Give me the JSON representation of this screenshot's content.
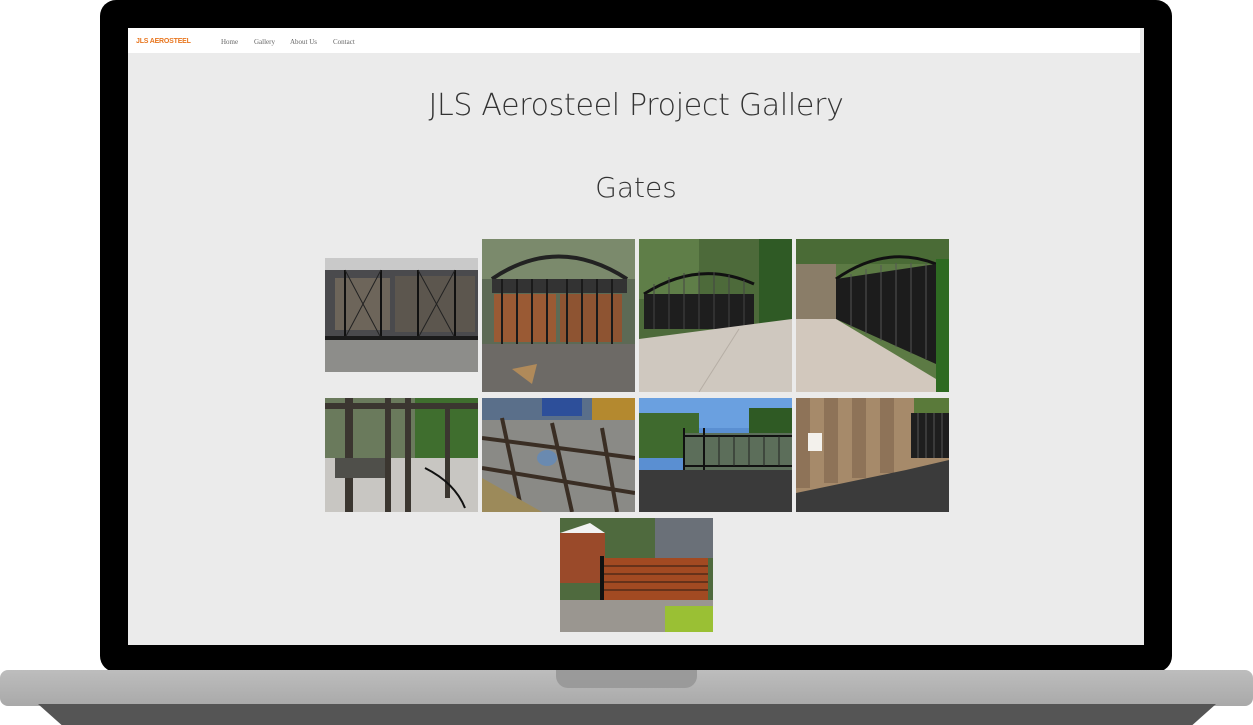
{
  "nav": {
    "brand": "JLS AEROSTEEL",
    "links": [
      "Home",
      "Gallery",
      "About Us",
      "Contact"
    ]
  },
  "main": {
    "title": "JLS Aerosteel Project Gallery",
    "section": "Gates"
  },
  "gallery": {
    "photos": [
      {
        "alt": "garage-glass-gate"
      },
      {
        "alt": "arched-wood-panel-gate"
      },
      {
        "alt": "black-arched-driveway-gate"
      },
      {
        "alt": "black-arched-gate-side-view"
      },
      {
        "alt": "gate-frame-in-progress"
      },
      {
        "alt": "gate-fabrication-welding"
      },
      {
        "alt": "black-sliding-gate"
      },
      {
        "alt": "wooden-fence-gate"
      },
      {
        "alt": "horizontal-wood-slat-gate"
      }
    ]
  }
}
